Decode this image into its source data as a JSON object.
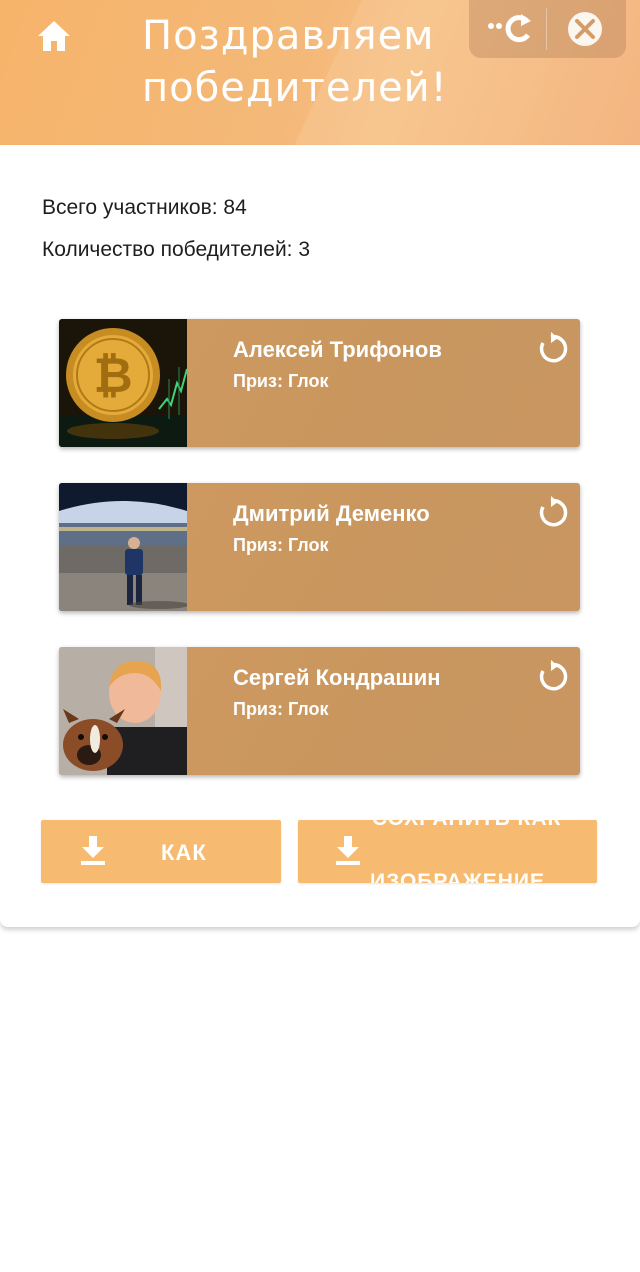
{
  "header": {
    "title": "Поздравляем победителей!"
  },
  "stats": {
    "total_participants": "Всего участников: 84",
    "winners_count": "Количество победителей: 3"
  },
  "winners": [
    {
      "name": "Алексей Трифонов",
      "prize": "Приз: Глок"
    },
    {
      "name": "Дмитрий Деменко",
      "prize": "Приз: Глок"
    },
    {
      "name": "Сергей Кондрашин",
      "prize": "Приз: Глок"
    }
  ],
  "buttons": {
    "save_short": "КАК",
    "save_image_line1": "СОХРАНИТЬ КАК",
    "save_image_line2": "ИЗОБРАЖЕНИЕ"
  },
  "icons": {
    "home": "home-icon",
    "more": "more-icon",
    "reload": "reload-icon",
    "close": "close-icon",
    "reroll": "reroll-icon",
    "download": "download-icon"
  },
  "colors": {
    "header": "#f6b46a",
    "card_item": "#c8965e",
    "button": "#f6bb70"
  }
}
